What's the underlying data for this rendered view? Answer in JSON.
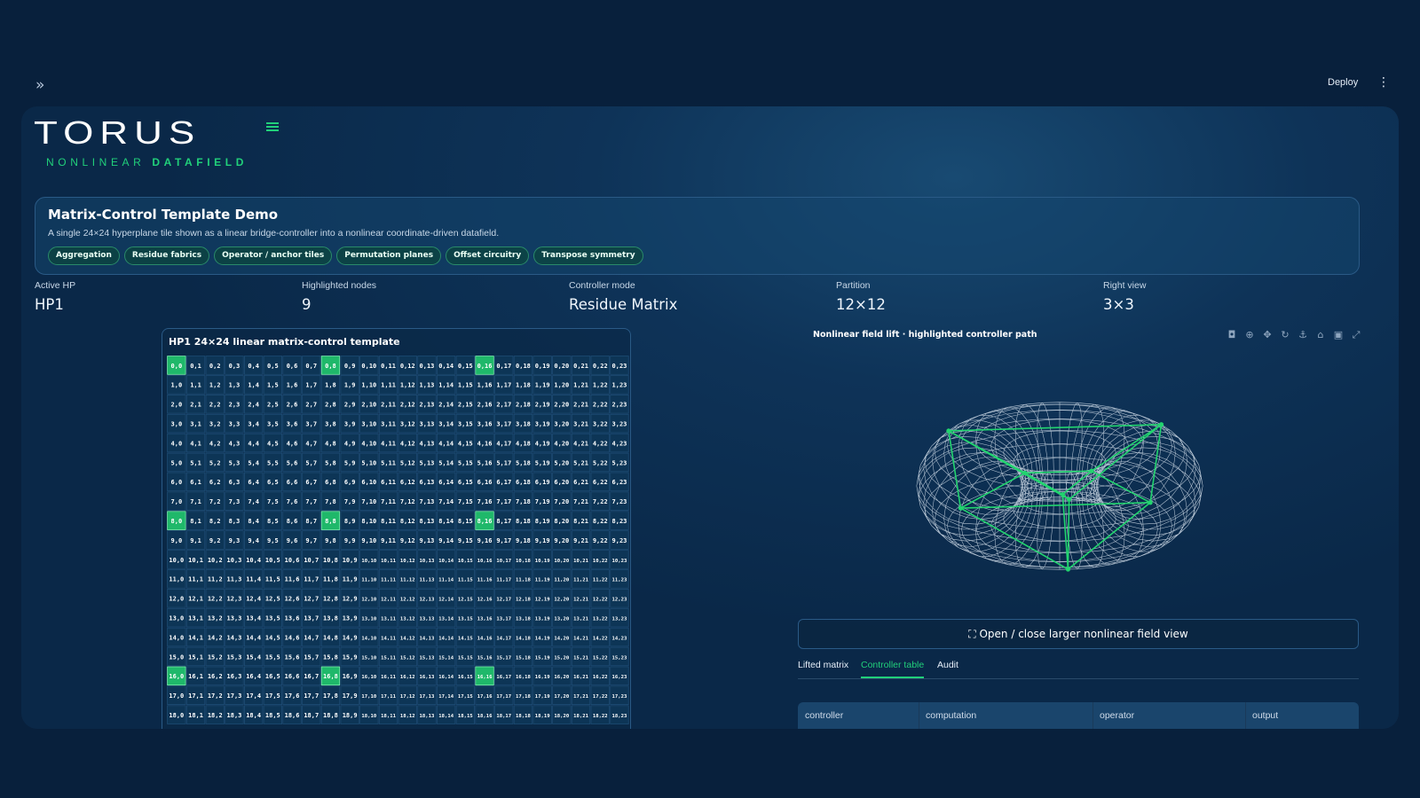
{
  "topbar": {
    "deploy_label": "Deploy",
    "expand_icon": "double-chevron-right-icon",
    "menu_icon": "kebab-menu-icon"
  },
  "logo": {
    "title": "TORUS",
    "subtitle_a": "NONLINEAR",
    "subtitle_b": "DATAFIELD"
  },
  "hero": {
    "title": "Matrix-Control Template Demo",
    "description": "A single 24×24 hyperplane tile shown as a linear bridge-controller into a nonlinear coordinate-driven datafield.",
    "chips": [
      "Aggregation",
      "Residue fabrics",
      "Operator / anchor tiles",
      "Permutation planes",
      "Offset circuitry",
      "Transpose symmetry"
    ]
  },
  "metrics": [
    {
      "label": "Active HP",
      "value": "HP1"
    },
    {
      "label": "Highlighted nodes",
      "value": "9"
    },
    {
      "label": "Controller mode",
      "value": "Residue Matrix"
    },
    {
      "label": "Partition",
      "value": "12×12"
    },
    {
      "label": "Right view",
      "value": "3×3"
    }
  ],
  "matrix": {
    "title": "HP1 24×24 linear matrix-control template",
    "size": 24,
    "visible_rows": 19,
    "highlighted": [
      [
        0,
        0
      ],
      [
        0,
        8
      ],
      [
        0,
        16
      ],
      [
        8,
        0
      ],
      [
        8,
        8
      ],
      [
        8,
        16
      ],
      [
        16,
        0
      ],
      [
        16,
        8
      ],
      [
        16,
        16
      ]
    ],
    "colors": {
      "cell": "#0d3556",
      "cell_border": "#1d4c74",
      "highlight": "#1fb86a",
      "text": "#ffffff"
    }
  },
  "plot": {
    "title": "Nonlinear field lift · highlighted controller path",
    "modebar": [
      "camera-icon",
      "zoom-icon",
      "pan-icon",
      "orbit-icon",
      "anchor-icon",
      "home-icon",
      "video-icon",
      "fullscreen-icon"
    ],
    "colors": {
      "mesh": "#dfe8f2",
      "path": "#22d46f"
    }
  },
  "open_button_label": "⛶ Open / close larger nonlinear field view",
  "tabs": [
    {
      "label": "Lifted matrix",
      "active": false
    },
    {
      "label": "Controller table",
      "active": true
    },
    {
      "label": "Audit",
      "active": false
    }
  ],
  "table": {
    "columns": [
      "controller",
      "computation",
      "operator",
      "output"
    ]
  }
}
